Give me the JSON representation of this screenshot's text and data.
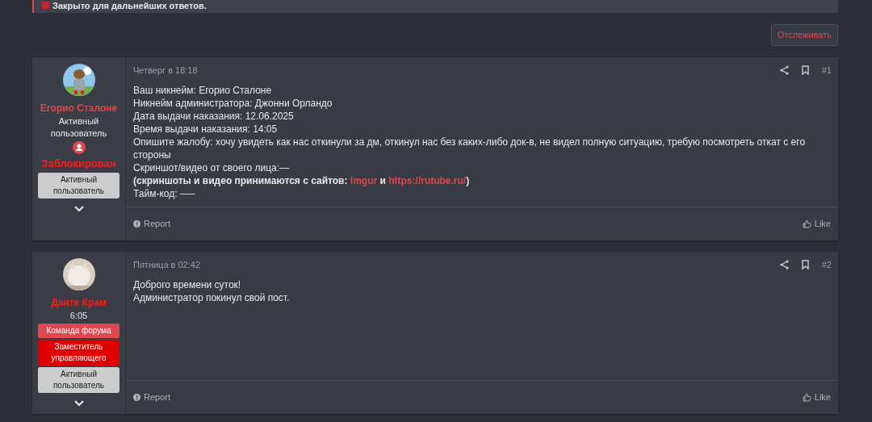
{
  "notice": {
    "text": "Закрыто для дальнейших ответов."
  },
  "watch_button": {
    "label": "Отслеживать"
  },
  "posts": [
    {
      "user": {
        "name": "Егорио Сталоне",
        "color": "#e0474f",
        "title": "Активный пользователь",
        "status": "Заблокирован",
        "banners": [
          {
            "text": "Активный пользователь",
            "color": "#cccccc"
          }
        ]
      },
      "date": "Четверг в 18:18",
      "number": "#1",
      "lines": [
        {
          "bold": false,
          "parts": [
            {
              "kind": "text",
              "text": "Ваш никнейм: Егорио Сталоне"
            }
          ]
        },
        {
          "bold": false,
          "parts": [
            {
              "kind": "text",
              "text": "Никнейм администратора: Джонни Орландо"
            }
          ]
        },
        {
          "bold": false,
          "parts": [
            {
              "kind": "text",
              "text": "Дата выдачи наказания: 12.06.2025"
            }
          ]
        },
        {
          "bold": false,
          "parts": [
            {
              "kind": "text",
              "text": "Время выдачи наказания: 14:05"
            }
          ]
        },
        {
          "bold": false,
          "parts": [
            {
              "kind": "text",
              "text": "Опишите жалобу: хочу увидеть как нас откинули за дм, откинул нас без каких-либо док-в, не видел полную ситуацию, требую посмотреть откат с его стороны"
            }
          ]
        },
        {
          "bold": false,
          "parts": [
            {
              "kind": "text",
              "text": "Скриншот/видео от своего лица:—"
            }
          ]
        },
        {
          "bold": true,
          "parts": [
            {
              "kind": "text",
              "text": "(скриншоты и видео принимаются с сайтов: "
            },
            {
              "kind": "link",
              "text": "Imgur"
            },
            {
              "kind": "text",
              "text": " и "
            },
            {
              "kind": "link",
              "text": "https://rutube.ru/"
            },
            {
              "kind": "text",
              "text": ")"
            }
          ]
        },
        {
          "bold": false,
          "parts": [
            {
              "kind": "text",
              "text": "Тайм-код: —–"
            }
          ]
        }
      ],
      "report": "Report",
      "like": "Like"
    },
    {
      "user": {
        "name": "Данте Крам",
        "color": "#ff1a1a",
        "title": "6:05",
        "banners": [
          {
            "text": "Команда форума",
            "color": "#e0474f"
          },
          {
            "text": "Заместитель управляющего",
            "color": "#e00000"
          },
          {
            "text": "Активный пользователь",
            "color": "#cccccc"
          }
        ]
      },
      "date": "Пятница в 02:42",
      "number": "#2",
      "lines": [
        {
          "bold": false,
          "parts": [
            {
              "kind": "text",
              "text": "Доброго времени суток!"
            }
          ]
        },
        {
          "bold": false,
          "parts": [
            {
              "kind": "text",
              "text": "Администратор покинул свой пост."
            }
          ]
        }
      ],
      "report": "Report",
      "like": "Like"
    }
  ]
}
